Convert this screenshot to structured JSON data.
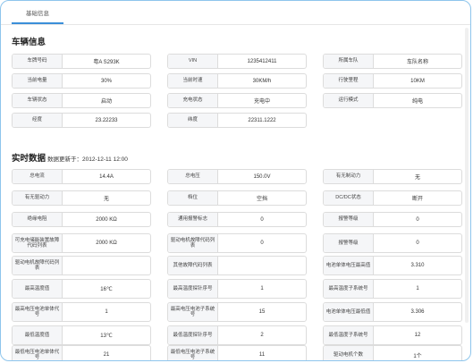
{
  "tabs": [
    {
      "label": "基础信息"
    }
  ],
  "vehicle": {
    "title": "车辆信息",
    "fields": [
      {
        "label": "车牌号码",
        "value": "粤A S293K"
      },
      {
        "label": "VIN",
        "value": "1235412411"
      },
      {
        "label": "所属车队",
        "value": "车队名称"
      },
      {
        "label": "当前电量",
        "value": "30%"
      },
      {
        "label": "当前时速",
        "value": "30KM/h"
      },
      {
        "label": "行驶里程",
        "value": "10KM"
      },
      {
        "label": "车辆状态",
        "value": "启动"
      },
      {
        "label": "充电状态",
        "value": "充电中"
      },
      {
        "label": "运行模式",
        "value": "纯电"
      },
      {
        "label": "经度",
        "value": "23.22233"
      },
      {
        "label": "纬度",
        "value": "22311.1222"
      }
    ]
  },
  "realtime": {
    "title": "实时数据",
    "updated_prefix": "数据更新于：",
    "updated_time": "2012-12-11 12:00",
    "fields": [
      {
        "label": "总电流",
        "value": "14.4A"
      },
      {
        "label": "总电压",
        "value": "150.0V"
      },
      {
        "label": "有无制动力",
        "value": "无"
      },
      {
        "label": "有无驱动力",
        "value": "无"
      },
      {
        "label": "档位",
        "value": "空挡"
      },
      {
        "label": "DC/DC状态",
        "value": "断开"
      },
      {
        "label": "绝缘电阻",
        "value": "2000 KΩ"
      },
      {
        "label": "通用报警标志",
        "value": "0"
      },
      {
        "label": "报警等级",
        "value": "0"
      },
      {
        "label": "可充电储能装置故障代码列表",
        "value": "2000 KΩ"
      },
      {
        "label": "驱动电机故障代码列表",
        "value": "0"
      },
      {
        "label": "报警等级",
        "value": "0"
      },
      {
        "label": "驱动电机故障代码列表",
        "value": ""
      },
      {
        "label": "其他故障代码列表",
        "value": ""
      },
      {
        "label": "电池单体电压最高值",
        "value": "3.310"
      },
      {
        "label": "最高温度值",
        "value": "16℃"
      },
      {
        "label": "最高温度探针序号",
        "value": "1"
      },
      {
        "label": "最高温度子系统号",
        "value": "1"
      },
      {
        "label": "最高电压电池单体代号",
        "value": "1"
      },
      {
        "label": "最高电压电池子系统号",
        "value": "15"
      },
      {
        "label": "电池单体电压最低值",
        "value": "3.306"
      },
      {
        "label": "最低温度值",
        "value": "13℃"
      },
      {
        "label": "最低温度探针序号",
        "value": "2"
      },
      {
        "label": "最低温度子系统号",
        "value": "12"
      },
      {
        "label": "最低电压电池单体代号",
        "value": "21"
      },
      {
        "label": "最低电压电池子系统号",
        "value": "11"
      },
      {
        "label": "驱动电机个数",
        "value": "1个"
      }
    ]
  }
}
